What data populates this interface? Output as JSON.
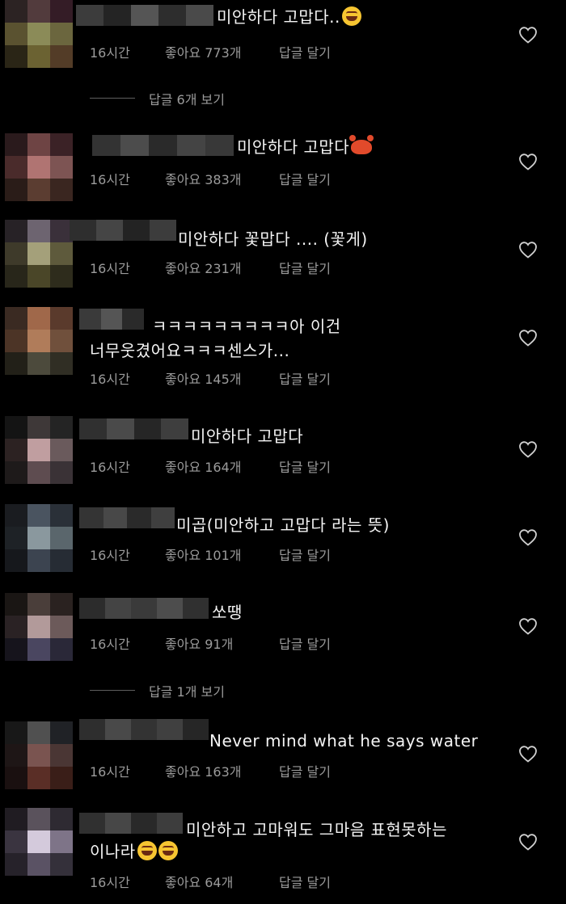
{
  "comments": [
    {
      "lines": [
        "미안하다 고맙다.."
      ],
      "emoji_after": "grinning-squint-face",
      "time": "16시간",
      "likes": "좋아요 773개",
      "reply": "답글 달기",
      "view_replies": "답글 6개 보기"
    },
    {
      "lines": [
        "미안하다 고맙다"
      ],
      "emoji_after": "crab",
      "time": "16시간",
      "likes": "좋아요 383개",
      "reply": "답글 달기"
    },
    {
      "lines": [
        "미안하다 꽃맙다 .... (꽃게)"
      ],
      "time": "16시간",
      "likes": "좋아요 231개",
      "reply": "답글 달기"
    },
    {
      "lines": [
        "ㅋㅋㅋㅋㅋㅋㅋㅋㅋ아 이건",
        "너무웃겼어요ㅋㅋㅋ센스가..."
      ],
      "time": "16시간",
      "likes": "좋아요 145개",
      "reply": "답글 달기"
    },
    {
      "lines": [
        "미안하다 고맙다"
      ],
      "time": "16시간",
      "likes": "좋아요 164개",
      "reply": "답글 달기"
    },
    {
      "lines": [
        "미곱(미안하고 고맙다 라는 뜻)"
      ],
      "time": "16시간",
      "likes": "좋아요 101개",
      "reply": "답글 달기"
    },
    {
      "lines": [
        "쏘땡"
      ],
      "time": "16시간",
      "likes": "좋아요 91개",
      "reply": "답글 달기",
      "view_replies": "답글 1개 보기"
    },
    {
      "lines": [
        "Never mind what he says water"
      ],
      "time": "16시간",
      "likes": "좋아요 163개",
      "reply": "답글 달기"
    },
    {
      "lines": [
        "미안하고 고마워도 그마음 표현못하는",
        "이나라"
      ],
      "emoji_after": "grinning-squint-face x2",
      "time": "16시간",
      "likes": "좋아요 64개",
      "reply": "답글 달기"
    }
  ],
  "icons": {
    "like": "heart-outline-icon"
  },
  "colors": {
    "background": "#000000",
    "text": "#f4f4f4",
    "meta": "#9b9b9b",
    "divider": "#5f5f5f"
  }
}
